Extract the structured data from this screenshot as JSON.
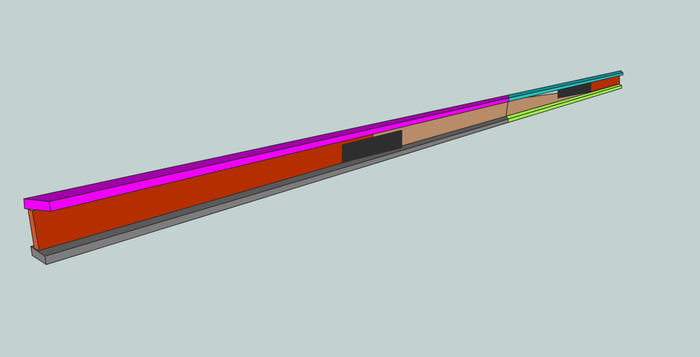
{
  "viewport": {
    "background": "#c4d1d1"
  },
  "model": {
    "name": "i-beam-3d-model",
    "colors": {
      "top_flange_magenta_top": "#a000a8",
      "top_flange_magenta_front": "#f000f8",
      "top_flange_cyan_top": "#0c8f8f",
      "top_flange_cyan_front": "#22c3c3",
      "web_red": "#b42e00",
      "web_tan": "#b88c68",
      "web_end_shade": "#d0552a",
      "bottom_flange_gray_top": "#5a5a5a",
      "bottom_flange_gray_front": "#7d7d7d",
      "bottom_flange_green": "#9ef04a",
      "plate_dark": "#2e2e2e"
    }
  }
}
